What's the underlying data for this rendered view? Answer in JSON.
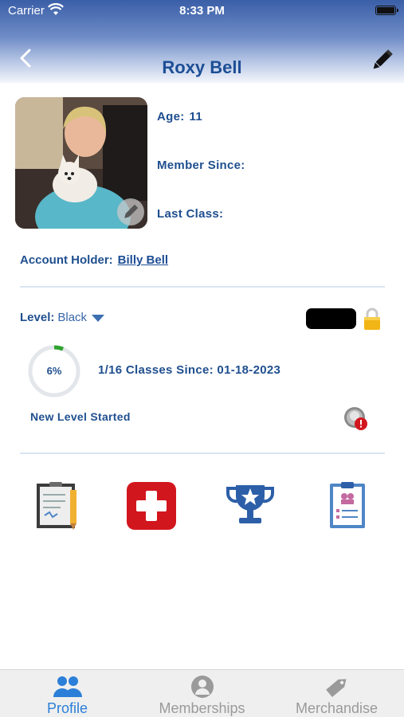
{
  "status_bar": {
    "carrier": "Carrier",
    "time": "8:33 PM"
  },
  "header": {
    "title": "Roxy Bell"
  },
  "profile": {
    "age_label": "Age:",
    "age_value": "11",
    "member_since_label": "Member Since:",
    "last_class_label": "Last Class:",
    "account_holder_label": "Account Holder:",
    "account_holder_name": "Billy Bell"
  },
  "level": {
    "label": "Level:",
    "value": "Black",
    "progress_text": "6%",
    "progress_fraction": 0.06,
    "classes_since": "1/16 Classes Since: 01-18-2023",
    "status": "New Level Started"
  },
  "actions": [
    {
      "icon": "clipboard-notes-icon"
    },
    {
      "icon": "medical-cross-icon"
    },
    {
      "icon": "trophy-icon"
    },
    {
      "icon": "checklist-icon"
    }
  ],
  "tabbar": {
    "tabs": [
      {
        "label": "Profile",
        "icon": "people-icon",
        "active": true
      },
      {
        "label": "Memberships",
        "icon": "user-circle-icon",
        "active": false
      },
      {
        "label": "Merchandise",
        "icon": "tag-icon",
        "active": false
      }
    ]
  },
  "colors": {
    "brand_blue": "#1d4e95",
    "active_tab": "#2b7fd8",
    "medical_red": "#d2161e",
    "progress_green": "#2ea32e",
    "lock_gold": "#f2b516"
  }
}
